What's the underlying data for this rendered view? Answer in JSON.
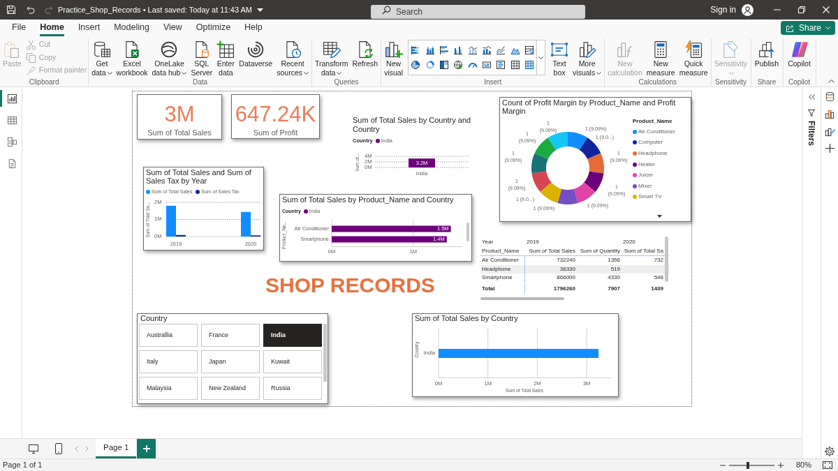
{
  "title_bar": {
    "document_title": "Practice_Shop_Records • Last saved: Today at 11:43 AM",
    "search": {
      "placeholder": "Search"
    },
    "sign_in": "Sign in"
  },
  "ribbon_tabs": [
    {
      "label": "File",
      "selected": false
    },
    {
      "label": "Home",
      "selected": true
    },
    {
      "label": "Insert",
      "selected": false
    },
    {
      "label": "Modeling",
      "selected": false
    },
    {
      "label": "View",
      "selected": false
    },
    {
      "label": "Optimize",
      "selected": false
    },
    {
      "label": "Help",
      "selected": false
    }
  ],
  "share_button": {
    "label": "Share"
  },
  "ribbon_groups": [
    {
      "label": "Clipboard",
      "items": [
        {
          "kind": "large",
          "lines": [
            "Paste"
          ],
          "dropdown": false,
          "disabled": true
        },
        {
          "kind": "small",
          "lines": [
            "Cut"
          ],
          "dropdown": false,
          "disabled": true
        },
        {
          "kind": "small",
          "lines": [
            "Copy"
          ],
          "dropdown": false,
          "disabled": true
        },
        {
          "kind": "small",
          "lines": [
            "Format painter"
          ],
          "dropdown": false,
          "disabled": true
        }
      ]
    },
    {
      "label": "Data",
      "items": [
        {
          "kind": "large",
          "lines": [
            "Get",
            "data"
          ],
          "dropdown": true,
          "disabled": false
        },
        {
          "kind": "large",
          "lines": [
            "Excel",
            "workbook"
          ],
          "dropdown": false,
          "disabled": false
        },
        {
          "kind": "large",
          "lines": [
            "OneLake",
            "data hub"
          ],
          "dropdown": true,
          "disabled": false
        },
        {
          "kind": "large",
          "lines": [
            "SQL",
            "Server"
          ],
          "dropdown": false,
          "disabled": false
        },
        {
          "kind": "large",
          "lines": [
            "Enter",
            "data"
          ],
          "dropdown": false,
          "disabled": false
        },
        {
          "kind": "large",
          "lines": [
            "Dataverse"
          ],
          "dropdown": false,
          "disabled": false
        },
        {
          "kind": "large",
          "lines": [
            "Recent",
            "sources"
          ],
          "dropdown": true,
          "disabled": false
        }
      ]
    },
    {
      "label": "Queries",
      "items": [
        {
          "kind": "large",
          "lines": [
            "Transform",
            "data"
          ],
          "dropdown": true,
          "disabled": false
        },
        {
          "kind": "large",
          "lines": [
            "Refresh"
          ],
          "dropdown": false,
          "disabled": false
        }
      ]
    },
    {
      "label": "Insert",
      "items": [
        {
          "kind": "large",
          "lines": [
            "New",
            "visual"
          ],
          "dropdown": false,
          "disabled": false
        },
        {
          "kind": "gallery"
        },
        {
          "kind": "large",
          "lines": [
            "Text",
            "box"
          ],
          "dropdown": false,
          "disabled": false
        },
        {
          "kind": "large",
          "lines": [
            "More",
            "visuals"
          ],
          "dropdown": true,
          "disabled": false
        }
      ]
    },
    {
      "label": "Calculations",
      "items": [
        {
          "kind": "large",
          "lines": [
            "New",
            "calculation"
          ],
          "dropdown": false,
          "disabled": true
        },
        {
          "kind": "large",
          "lines": [
            "New",
            "measure"
          ],
          "dropdown": false,
          "disabled": false
        },
        {
          "kind": "large",
          "lines": [
            "Quick",
            "measure"
          ],
          "dropdown": false,
          "disabled": false
        }
      ]
    },
    {
      "label": "Sensitivity",
      "items": [
        {
          "kind": "large",
          "lines": [
            "Sensitivity"
          ],
          "dropdown": true,
          "disabled": true
        }
      ]
    },
    {
      "label": "Share",
      "items": [
        {
          "kind": "large",
          "lines": [
            "Publish"
          ],
          "dropdown": false,
          "disabled": false
        }
      ]
    },
    {
      "label": "Copilot",
      "items": [
        {
          "kind": "large",
          "lines": [
            "Copilot"
          ],
          "dropdown": false,
          "disabled": false
        }
      ]
    }
  ],
  "view_rail": [
    {
      "selected": true
    },
    {
      "selected": false
    },
    {
      "selected": false
    },
    {
      "selected": false
    }
  ],
  "cards": [
    {
      "value": "3M",
      "label": "Sum of Total Sales"
    },
    {
      "value": "647.24K",
      "label": "Sum of Profit"
    }
  ],
  "sales_by_country_column_chart": {
    "chart_data": [
      {
        "type": "bar",
        "title": "Sum of Total Sales by Country and Country",
        "legend_title": "Country",
        "ylabel": "Sum of...",
        "categories": [
          "India"
        ],
        "series": [
          {
            "name": "India",
            "color": "#6b007b",
            "values": [
              3.2
            ]
          }
        ],
        "yticks": [
          {
            "value": 0,
            "label": "0M"
          },
          {
            "value": 2,
            "label": "2M"
          },
          {
            "value": 4,
            "label": "4M"
          }
        ],
        "ylim": [
          0,
          4
        ],
        "value_labels": [
          "3.2M"
        ],
        "grid": true
      }
    ]
  },
  "profit_margin_donut": {
    "chart_data": [
      {
        "type": "donut",
        "title": "Count of Profit Margin by Product_Name and Profit Margin",
        "legend_title": "Product_Name",
        "legend": "right",
        "categories": [
          "Air Conditioner",
          "Computer",
          "Headphone",
          "Heater",
          "Juicer",
          "Mixer",
          "Smart TV",
          null,
          null,
          null,
          null
        ],
        "values": [
          1,
          1,
          1,
          1,
          1,
          1,
          1,
          1,
          1,
          1,
          1
        ],
        "colors": [
          "#118dff",
          "#12239e",
          "#e66c37",
          "#6b007b",
          "#e044a7",
          "#744ec2",
          "#d9b300",
          "#d64550",
          "#197278",
          "#1aab40",
          "#15c6f4"
        ],
        "value_labels": [
          "1 (9.09%)",
          "1 (9.0...)",
          "1 (9.09%)",
          "1 (9.09%)",
          "1 (9.09%)",
          "1 (9.09%)",
          "1 (9.0...)",
          "1 (9.09%)",
          "1 (9.09%)",
          "1 (9.09%)",
          "1 (9.09%)"
        ]
      }
    ]
  },
  "sales_and_tax_by_year_chart": {
    "chart_data": [
      {
        "type": "bar",
        "title": "Sum of Total Sales and Sum of Sales Tax by Year",
        "ylabel": "Sum of Total Sa...",
        "legend": "top",
        "categories": [
          "2019",
          "2020"
        ],
        "series": [
          {
            "name": "Sum of Total Sales",
            "color": "#118dff",
            "values": [
              1.8,
              1.44
            ]
          },
          {
            "name": "Sum of Sales Tax",
            "color": "#12239e",
            "values": [
              0.09,
              0.07
            ]
          }
        ],
        "yticks": [
          {
            "value": 0,
            "label": "0M"
          },
          {
            "value": 1,
            "label": "1M"
          },
          {
            "value": 2,
            "label": "2M"
          }
        ],
        "ylim": [
          0,
          2
        ],
        "grid": true
      }
    ]
  },
  "sales_by_product_chart": {
    "chart_data": [
      {
        "type": "bar",
        "orientation": "horizontal",
        "title": "Sum of Total Sales by Product_Name and Country",
        "legend_title": "Country",
        "ylabel": "Product_Na...",
        "categories": [
          "Air Conditioner",
          "Smartphone"
        ],
        "series": [
          {
            "name": "India",
            "color": "#6b007b",
            "values": [
              1.46,
              1.41
            ]
          }
        ],
        "xticks": [
          {
            "value": 0,
            "label": "0M"
          },
          {
            "value": 1,
            "label": "1M"
          }
        ],
        "xlim": [
          0,
          1.6
        ],
        "value_labels": [
          "1.5M",
          "1.4M"
        ],
        "grid": true
      }
    ]
  },
  "matrix": {
    "column_header": "Year",
    "row_header": "Product_Name",
    "column_groups": [
      {
        "label": "2019",
        "columns": [
          "Sum of Total Sales",
          "Sum of Quantity"
        ]
      },
      {
        "label": "2020",
        "columns": [
          "Sum of Total Sa"
        ]
      }
    ],
    "rows": [
      {
        "cells": [
          "Air Conditioner",
          "732240",
          "1356",
          "732"
        ]
      },
      {
        "cells": [
          "Headphone",
          "36330",
          "519"
        ]
      },
      {
        "cells": [
          "Smartphone",
          "866000",
          "4330",
          "546"
        ]
      }
    ],
    "total": {
      "cells": [
        "Total",
        "1796260",
        "7907",
        "1439"
      ]
    }
  },
  "text_box": {
    "text": "SHOP RECORDS"
  },
  "country_slicer": {
    "title": "Country",
    "options": [
      {
        "label": "Australlia",
        "selected": false
      },
      {
        "label": "France",
        "selected": false
      },
      {
        "label": "India",
        "selected": true
      },
      {
        "label": "Italy",
        "selected": false
      },
      {
        "label": "Japan",
        "selected": false
      },
      {
        "label": "Kuwait",
        "selected": false
      },
      {
        "label": "Malaysia",
        "selected": false
      },
      {
        "label": "New Zealand",
        "selected": false
      },
      {
        "label": "Russia",
        "selected": false
      }
    ]
  },
  "sales_by_country_bar_chart": {
    "chart_data": [
      {
        "type": "bar",
        "orientation": "horizontal",
        "title": "Sum of Total Sales by Country",
        "xlabel": "Sum of Total Sales",
        "ylabel": "Country",
        "categories": [
          "India"
        ],
        "values": [
          3.24
        ],
        "color": "#118dff",
        "xticks": [
          {
            "value": 0,
            "label": "0M"
          },
          {
            "value": 1,
            "label": "1M"
          },
          {
            "value": 2,
            "label": "2M"
          },
          {
            "value": 3,
            "label": "3M"
          }
        ],
        "xlim": [
          0,
          3.5
        ],
        "grid": true
      }
    ]
  },
  "filters_pane": {
    "title": "Filters"
  },
  "pages": [
    {
      "label": "Page 1",
      "selected": true
    }
  ],
  "status_bar": {
    "page_info": "Page 1 of 1",
    "zoom": {
      "level": 0.42,
      "reading": "80%"
    }
  }
}
